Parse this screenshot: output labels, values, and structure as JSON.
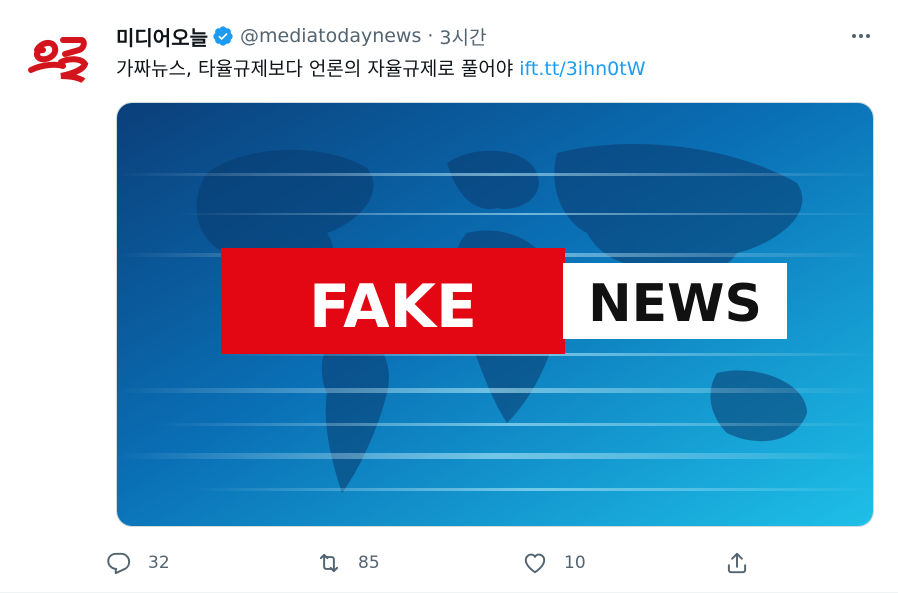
{
  "tweet": {
    "display_name": "미디어오늘",
    "handle": "@mediatodaynews",
    "separator": "·",
    "time": "3시간",
    "text": "가짜뉴스, 타율규제보다 언론의 자율규제로 풀어야",
    "link": "ift.tt/3ihn0tW",
    "avatar_logo_text": "오늘",
    "avatar_icon": "mediatoday-logo-icon",
    "verified_icon": "verified-badge-icon",
    "more_icon": "more-options-icon"
  },
  "media": {
    "fake_label": "FAKE",
    "news_label": "NEWS",
    "colors": {
      "fake_bg": "#e30613",
      "news_bg": "#ffffff",
      "backdrop": "#0a6fb5"
    }
  },
  "actions": {
    "reply": {
      "icon": "reply-icon",
      "count": "32"
    },
    "retweet": {
      "icon": "retweet-icon",
      "count": "85"
    },
    "like": {
      "icon": "heart-icon",
      "count": "10"
    },
    "share": {
      "icon": "share-icon",
      "count": ""
    }
  },
  "colors": {
    "link": "#1d9bf0",
    "secondary_text": "#536471",
    "verified": "#1d9bf0"
  }
}
